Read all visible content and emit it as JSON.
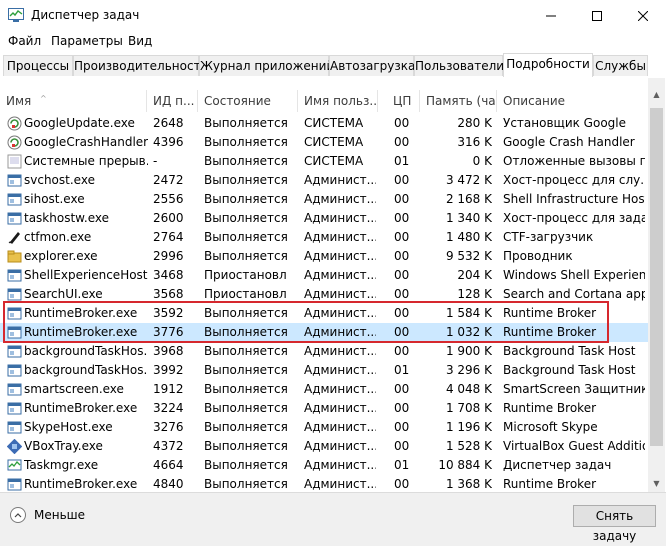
{
  "window": {
    "title": "Диспетчер задач"
  },
  "menu": [
    "Файл",
    "Параметры",
    "Вид"
  ],
  "tabs": [
    "Процессы",
    "Производительность",
    "Журнал приложений",
    "Автозагрузка",
    "Пользователи",
    "Подробности",
    "Службы"
  ],
  "active_tab": "Подробности",
  "columns": [
    "Имя",
    "ИД п...",
    "Состояние",
    "Имя польз...",
    "ЦП",
    "Память (ча...",
    "Описание"
  ],
  "rows": [
    {
      "icon": "google-update-icon",
      "name": "GoogleUpdate.exe",
      "pid": "2648",
      "state": "Выполняется",
      "user": "СИСТЕМА",
      "cpu": "00",
      "mem": "280 K",
      "desc": "Установщик Google"
    },
    {
      "icon": "google-crash-icon",
      "name": "GoogleCrashHandler...",
      "pid": "4396",
      "state": "Выполняется",
      "user": "СИСТЕМА",
      "cpu": "00",
      "mem": "316 K",
      "desc": "Google Crash Handler"
    },
    {
      "icon": "system-icon",
      "name": "Системные прерыв...",
      "pid": "-",
      "state": "Выполняется",
      "user": "СИСТЕМА",
      "cpu": "01",
      "mem": "0 K",
      "desc": "Отложенные вызовы пр"
    },
    {
      "icon": "app-icon",
      "name": "svchost.exe",
      "pid": "2472",
      "state": "Выполняется",
      "user": "Админист...",
      "cpu": "00",
      "mem": "3 472 K",
      "desc": "Хост-процесс для слу..."
    },
    {
      "icon": "app-icon",
      "name": "sihost.exe",
      "pid": "2556",
      "state": "Выполняется",
      "user": "Админист...",
      "cpu": "00",
      "mem": "2 168 K",
      "desc": "Shell Infrastructure Host"
    },
    {
      "icon": "app-icon",
      "name": "taskhostw.exe",
      "pid": "2600",
      "state": "Выполняется",
      "user": "Админист...",
      "cpu": "00",
      "mem": "1 340 K",
      "desc": "Хост-процесс для зада..."
    },
    {
      "icon": "pen-icon",
      "name": "ctfmon.exe",
      "pid": "2764",
      "state": "Выполняется",
      "user": "Админист...",
      "cpu": "00",
      "mem": "1 480 K",
      "desc": "CTF-загрузчик"
    },
    {
      "icon": "folder-icon",
      "name": "explorer.exe",
      "pid": "2996",
      "state": "Выполняется",
      "user": "Админист...",
      "cpu": "00",
      "mem": "9 532 K",
      "desc": "Проводник"
    },
    {
      "icon": "app-icon",
      "name": "ShellExperienceHost...",
      "pid": "3468",
      "state": "Приостановл",
      "user": "Админист...",
      "cpu": "00",
      "mem": "204 K",
      "desc": "Windows Shell Experien..."
    },
    {
      "icon": "app-icon",
      "name": "SearchUI.exe",
      "pid": "3568",
      "state": "Приостановл",
      "user": "Админист...",
      "cpu": "00",
      "mem": "128 K",
      "desc": "Search and Cortana app..."
    },
    {
      "icon": "app-icon",
      "name": "RuntimeBroker.exe",
      "pid": "3592",
      "state": "Выполняется",
      "user": "Админист...",
      "cpu": "00",
      "mem": "1 584 K",
      "desc": "Runtime Broker"
    },
    {
      "icon": "app-icon",
      "name": "RuntimeBroker.exe",
      "pid": "3776",
      "state": "Выполняется",
      "user": "Админист...",
      "cpu": "00",
      "mem": "1 032 K",
      "desc": "Runtime Broker"
    },
    {
      "icon": "app-icon",
      "name": "backgroundTaskHos...",
      "pid": "3968",
      "state": "Выполняется",
      "user": "Админист...",
      "cpu": "00",
      "mem": "1 900 K",
      "desc": "Background Task Host"
    },
    {
      "icon": "app-icon",
      "name": "backgroundTaskHos...",
      "pid": "3992",
      "state": "Выполняется",
      "user": "Админист...",
      "cpu": "01",
      "mem": "3 296 K",
      "desc": "Background Task Host"
    },
    {
      "icon": "app-icon",
      "name": "smartscreen.exe",
      "pid": "1912",
      "state": "Выполняется",
      "user": "Админист...",
      "cpu": "00",
      "mem": "4 048 K",
      "desc": "SmartScreen Защитник..."
    },
    {
      "icon": "app-icon",
      "name": "RuntimeBroker.exe",
      "pid": "3224",
      "state": "Выполняется",
      "user": "Админист...",
      "cpu": "00",
      "mem": "1 708 K",
      "desc": "Runtime Broker"
    },
    {
      "icon": "app-icon",
      "name": "SkypeHost.exe",
      "pid": "3276",
      "state": "Выполняется",
      "user": "Админист...",
      "cpu": "00",
      "mem": "1 196 K",
      "desc": "Microsoft Skype"
    },
    {
      "icon": "vbox-icon",
      "name": "VBoxTray.exe",
      "pid": "4372",
      "state": "Выполняется",
      "user": "Админист...",
      "cpu": "00",
      "mem": "1 528 K",
      "desc": "VirtualBox Guest Additio..."
    },
    {
      "icon": "taskmgr-icon",
      "name": "Taskmgr.exe",
      "pid": "4664",
      "state": "Выполняется",
      "user": "Админист...",
      "cpu": "01",
      "mem": "10 884 K",
      "desc": "Диспетчер задач"
    },
    {
      "icon": "app-icon",
      "name": "RuntimeBroker.exe",
      "pid": "4840",
      "state": "Выполняется",
      "user": "Админист...",
      "cpu": "00",
      "mem": "1 368 K",
      "desc": "Runtime Broker"
    }
  ],
  "selected_row_index": 11,
  "footer": {
    "less_label": "Меньше",
    "end_task_label": "Снять задачу"
  },
  "colors": {
    "selected_row": "#cce8ff",
    "highlight_border": "#d6282e"
  }
}
